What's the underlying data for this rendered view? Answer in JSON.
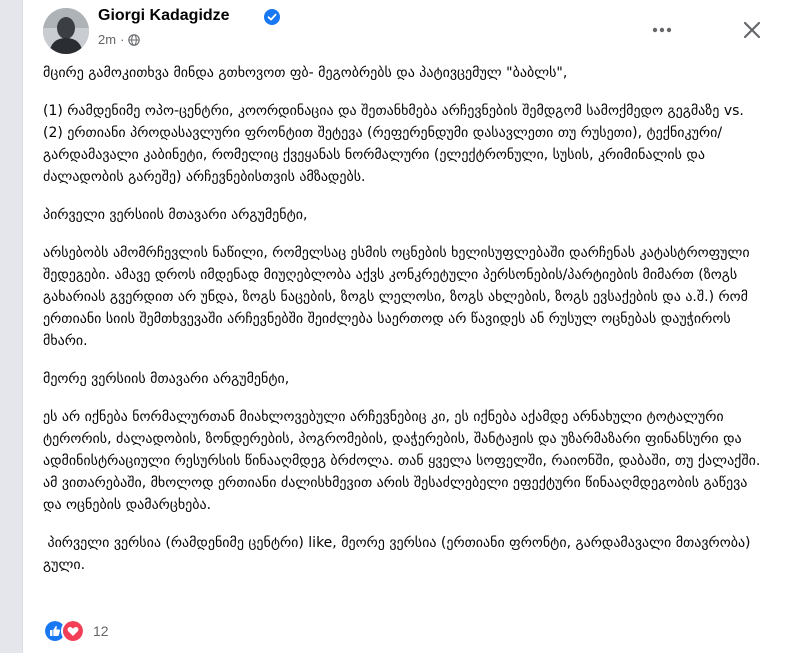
{
  "post": {
    "author": "Giorgi Kadagidze",
    "time": "2m",
    "separator": "·",
    "paragraphs": [
      "მცირე გამოკითხვა მინდა გთხოვოთ ფბ- მეგობრებს და პატივცემულ \"ბაბლს\",",
      "(1) რამდენიმე ოპო-ცენტრი, კოორდინაცია და შეთანხმება არჩევნების შემდგომ სამოქმედო გეგმაზე vs. (2) ერთიანი პროდასავლური ფრონტით შეტევა (რეფერენდუმი დასავლეთი თუ რუსეთი), ტექნიკური/გარდამავალი კაბინეტი, რომელიც ქვეყანას ნორმალური (ელექტრონული, სუსის, კრიმინალის და ძალადობის გარეშე) არჩევნებისთვის ამზადებს.",
      "პირველი ვერსიის მთავარი არგუმენტი,",
      "არსებობს ამომრჩევლის ნაწილი, რომელსაც ესმის ოცნების ხელისუფლებაში დარჩენას კატასტროფული შედეგები. ამავე დროს იმდენად მიუღებლობა აქვს კონკრეტული პერსონების/პარტიების მიმართ (ზოგს გახარიას გვერდით არ უნდა, ზოგს ნაცების, ზოგს ლელოსი, ზოგს ახლების, ზოგს ევსაქების და ა.შ.) რომ ერთიანი სიის შემთხვევაში არჩევნებში შეიძლება საერთოდ არ წავიდეს ან რუსულ ოცნებას დაუჭიროს მხარი.",
      "მეორე ვერსიის მთავარი არგუმენტი,",
      "ეს არ იქნება ნორმალურთან მიახლოვებული არჩევნებიც კი, ეს იქნება აქამდე არნახული ტოტალური ტერორის, ძალადობის, ზონდერების, პოგრომების, დაჭერების, შანტაჟის და უზარმაზარი ფინანსური და ადმინისტრაციული რესურსის წინააღმდეგ ბრძოლა. თან ყველა სოფელში, რაიონში, დაბაში, თუ ქალაქში. ამ ვითარებაში, მხოლოდ ერთიანი ძალისხმევით არის შესაძლებელი ეფექტური წინააღმდეგობის გაწევა და ოცნების დამარცხება.",
      " პირველი ვერსია (რამდენიმე ცენტრი) like, მეორე ვერსია (ერთიანი ფრონტი, გარდამავალი მთავრობა) გული."
    ],
    "reactions_count": "12"
  },
  "colors": {
    "verified": "#1877f2",
    "like": "#1877f2",
    "love": "#f33e58",
    "muted_text": "#65676b",
    "text": "#050505"
  },
  "icons": [
    "avatar",
    "verified-badge-icon",
    "globe-icon",
    "more-options-icon",
    "close-icon",
    "like-reaction-icon",
    "love-reaction-icon"
  ]
}
